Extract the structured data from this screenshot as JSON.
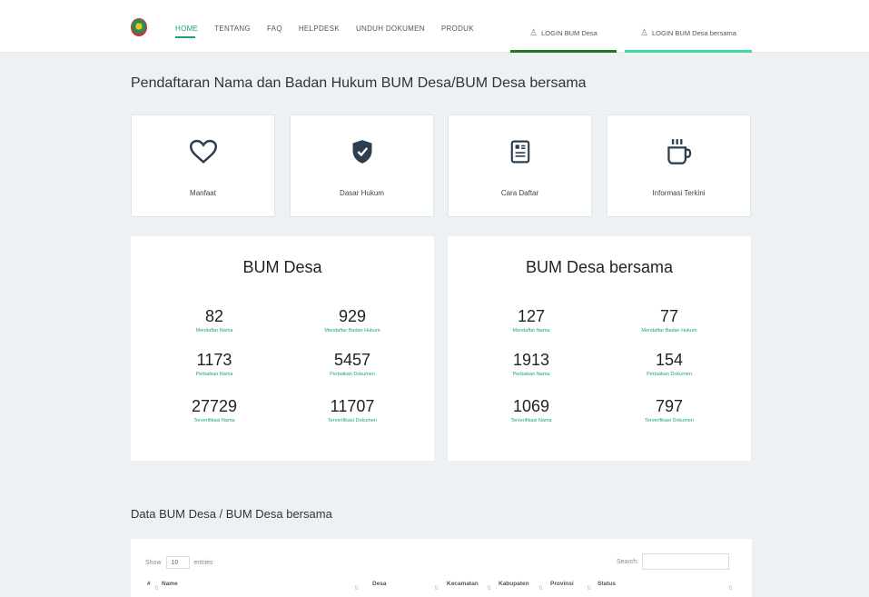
{
  "nav": {
    "links": [
      "HOME",
      "TENTANG",
      "FAQ",
      "HELPDESK",
      "UNDUH DOKUMEN",
      "PRODUK"
    ],
    "login_bum_desa": "LOGIN BUM Desa",
    "login_bum_desa_bersama": "LOGIN BUM Desa bersama",
    "accent": "#1aa57a"
  },
  "page_title": "Pendaftaran Nama dan Badan Hukum BUM Desa/BUM Desa bersama",
  "cards": [
    {
      "label": "Manfaat",
      "icon": "heart-icon"
    },
    {
      "label": "Dasar Hukum",
      "icon": "shield-check-icon"
    },
    {
      "label": "Cara Daftar",
      "icon": "document-list-icon"
    },
    {
      "label": "Informasi Terkini",
      "icon": "coffee-cup-icon"
    }
  ],
  "bum_desa": {
    "title": "BUM Desa",
    "stats": [
      {
        "value": "82",
        "label": "Mendaftar Nama"
      },
      {
        "value": "929",
        "label": "Mendaftar Badan Hukum"
      },
      {
        "value": "1173",
        "label": "Perbaikan Nama"
      },
      {
        "value": "5457",
        "label": "Perbaikan Dokumen"
      },
      {
        "value": "27729",
        "label": "Terverifikasi Nama"
      },
      {
        "value": "11707",
        "label": "Terverifikasi Dokumen"
      }
    ]
  },
  "bum_desa_bersama": {
    "title": "BUM Desa bersama",
    "stats": [
      {
        "value": "127",
        "label": "Mendaftar Nama"
      },
      {
        "value": "77",
        "label": "Mendaftar Badan Hukum"
      },
      {
        "value": "1913",
        "label": "Perbaikan Nama"
      },
      {
        "value": "154",
        "label": "Perbaikan Dokumen"
      },
      {
        "value": "1069",
        "label": "Terverifikasi Nama"
      },
      {
        "value": "797",
        "label": "Terverifikasi Dokumen"
      }
    ]
  },
  "data_section": {
    "title": "Data BUM Desa / BUM Desa bersama",
    "show_label": "Show",
    "entries_value": "10",
    "entries_label": "entries",
    "search_label": "Search:",
    "columns": [
      "#",
      "Name",
      "Desa",
      "Kecamatan",
      "Kabupaten",
      "Provinsi",
      "Status"
    ]
  }
}
